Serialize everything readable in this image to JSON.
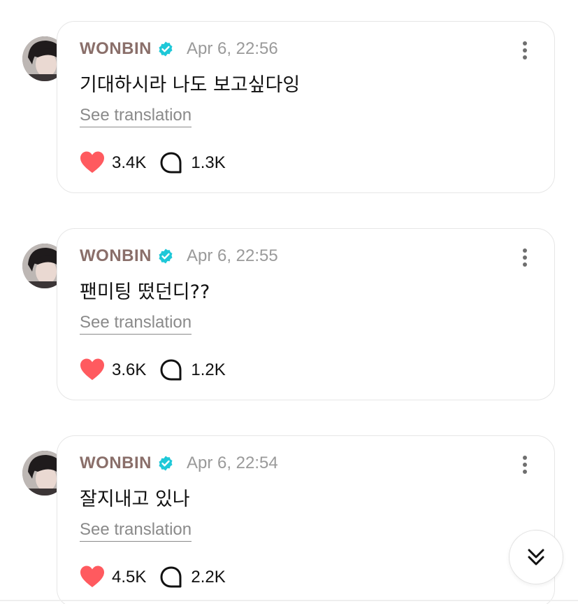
{
  "posts": [
    {
      "author": "WONBIN",
      "time": "Apr 6, 22:56",
      "text": "기대하시라 나도 보고싶다잉",
      "translate": "See translation",
      "likes": "3.4K",
      "comments": "1.3K"
    },
    {
      "author": "WONBIN",
      "time": "Apr 6, 22:55",
      "text": "팬미팅 떴던디??",
      "translate": "See translation",
      "likes": "3.6K",
      "comments": "1.2K"
    },
    {
      "author": "WONBIN",
      "time": "Apr 6, 22:54",
      "text": "잘지내고 있나",
      "translate": "See translation",
      "likes": "4.5K",
      "comments": "2.2K"
    }
  ],
  "colors": {
    "author": "#8a6f6a",
    "verified": "#1ec8d8",
    "heart": "#ff5a5f"
  },
  "icons": {
    "verified": "verified-badge-icon",
    "menu": "more-vertical-icon",
    "like": "heart-icon",
    "comment": "comment-bubble-icon",
    "scroll": "double-chevron-down-icon"
  }
}
